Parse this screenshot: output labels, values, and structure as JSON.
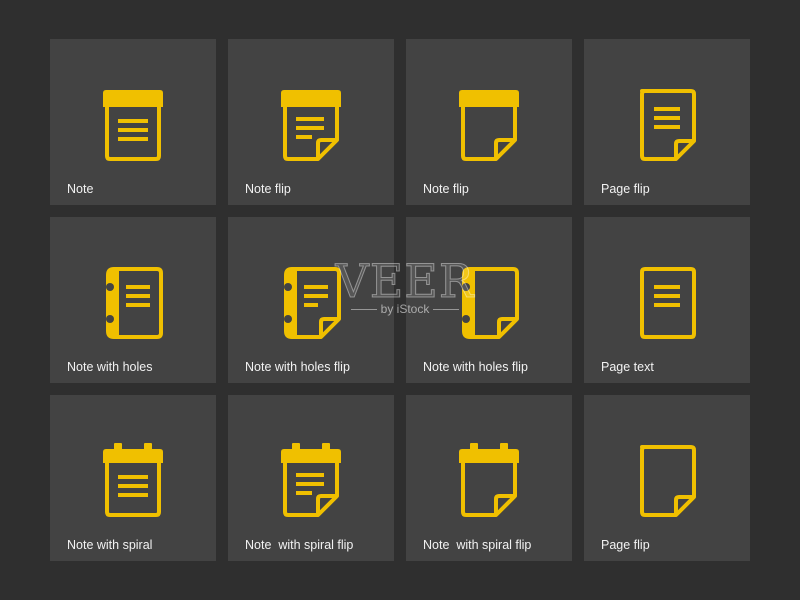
{
  "colors": {
    "background": "#2f2f2f",
    "tile": "#434343",
    "icon": "#f0c000",
    "label": "#f2f2f2"
  },
  "tiles": [
    {
      "label": "Note",
      "icon": "note-icon"
    },
    {
      "label": "Note flip",
      "icon": "note-flip-icon"
    },
    {
      "label": "Note flip",
      "icon": "note-flip-blank-icon"
    },
    {
      "label": "Page flip",
      "icon": "page-flip-text-icon"
    },
    {
      "label": "Note with holes",
      "icon": "note-with-holes-icon"
    },
    {
      "label": "Note with holes flip",
      "icon": "note-with-holes-flip-icon"
    },
    {
      "label": "Note with holes flip",
      "icon": "note-with-holes-flip-blank-icon"
    },
    {
      "label": "Page text",
      "icon": "page-text-icon"
    },
    {
      "label": "Note with spiral",
      "icon": "note-with-spiral-icon"
    },
    {
      "label": "Note  with spiral flip",
      "icon": "note-with-spiral-flip-icon"
    },
    {
      "label": "Note  with spiral flip",
      "icon": "note-with-spiral-flip-blank-icon"
    },
    {
      "label": "Page flip",
      "icon": "page-flip-blank-icon"
    }
  ],
  "watermark": {
    "brand": "VEER",
    "sub": "by iStock"
  }
}
